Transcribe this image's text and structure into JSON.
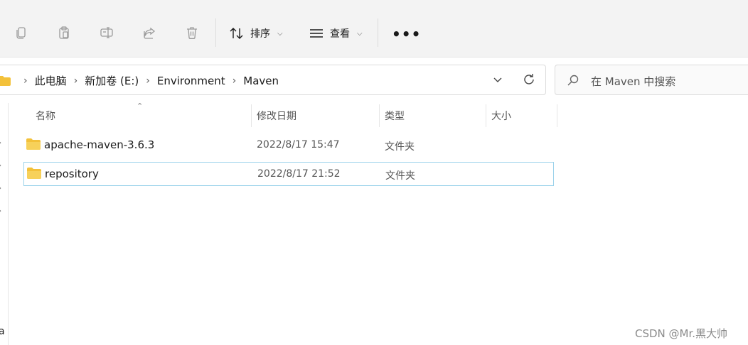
{
  "toolbar": {
    "icons": [
      "copy-icon",
      "paste-icon",
      "rename-icon",
      "share-icon",
      "delete-icon"
    ],
    "sort_label": "排序",
    "view_label": "查看",
    "more_label": "•••"
  },
  "address": {
    "crumbs": [
      "此电脑",
      "新加卷 (E:)",
      "Environment",
      "Maven"
    ]
  },
  "search": {
    "placeholder": "在 Maven 中搜索"
  },
  "columns": {
    "name": "名称",
    "date": "修改日期",
    "type": "类型",
    "size": "大小"
  },
  "files": [
    {
      "name": "apache-maven-3.6.3",
      "date": "2022/8/17 15:47",
      "type": "文件夹"
    },
    {
      "name": "repository",
      "date": "2022/8/17 21:52",
      "type": "文件夹"
    }
  ],
  "nav": {
    "fragment": "a"
  },
  "watermark": "CSDN @Mr.黑大帅",
  "colors": {
    "folder": "#f3c13a",
    "selection_border": "#99d1ea",
    "toolbar_bg": "#f3f3f3"
  }
}
